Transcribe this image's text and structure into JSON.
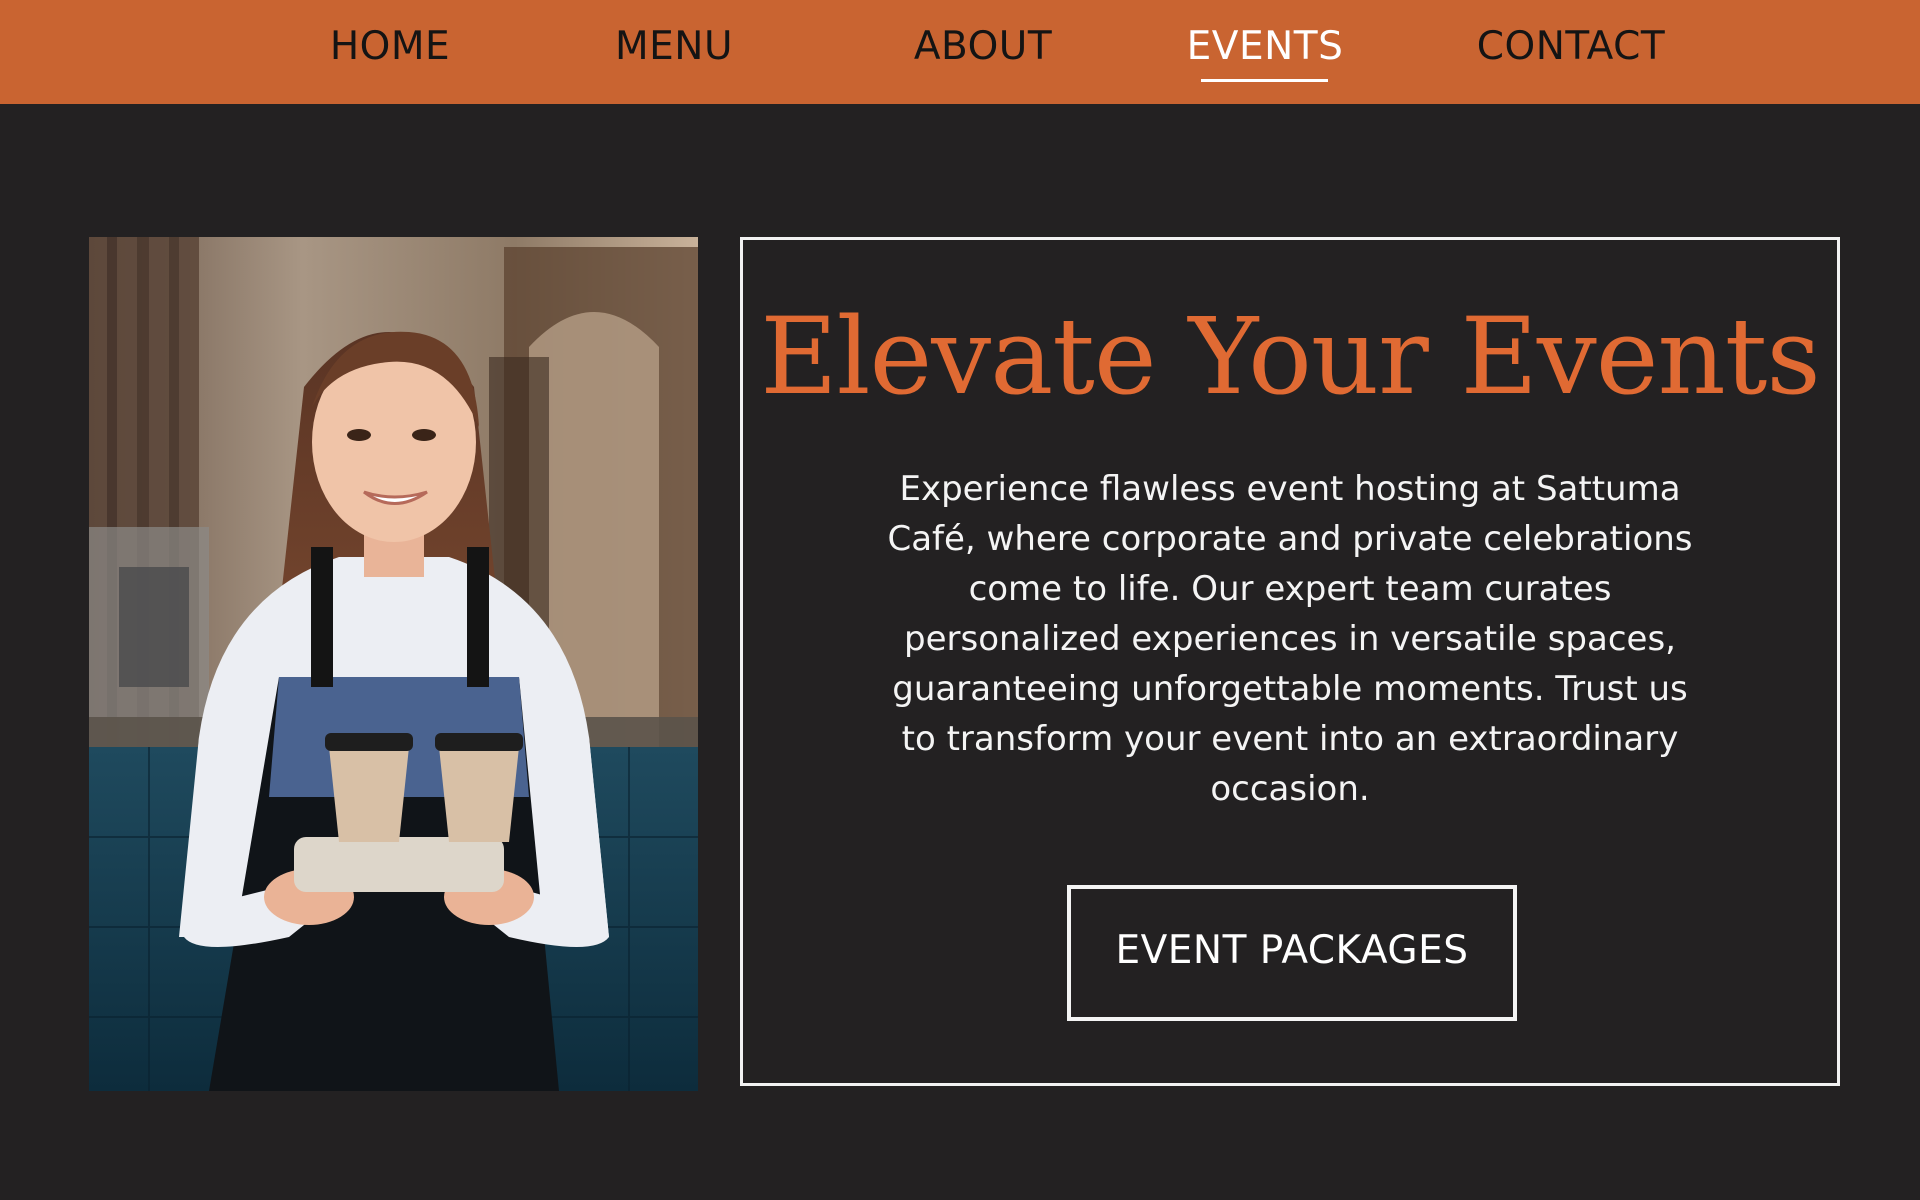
{
  "nav": {
    "items": [
      {
        "label": "HOME",
        "active": false
      },
      {
        "label": "MENU",
        "active": false
      },
      {
        "label": "ABOUT",
        "active": false
      },
      {
        "label": "EVENTS",
        "active": true
      },
      {
        "label": "CONTACT",
        "active": false
      }
    ]
  },
  "colors": {
    "nav_background": "#c96431",
    "page_background": "#232122",
    "title_accent": "#e06a33",
    "text_light": "#f4f4f4"
  },
  "hero": {
    "image_icon": "barista-holding-coffee-cups",
    "title": "Elevate Your Events",
    "description": "Experience flawless event hosting at Sattuma Café, where corporate and private celebrations come to life. Our expert team curates personalized experiences in versatile spaces, guaranteeing unforgettable moments. Trust us to transform your event into an extraordinary occasion.",
    "button_label": "EVENT PACKAGES"
  }
}
